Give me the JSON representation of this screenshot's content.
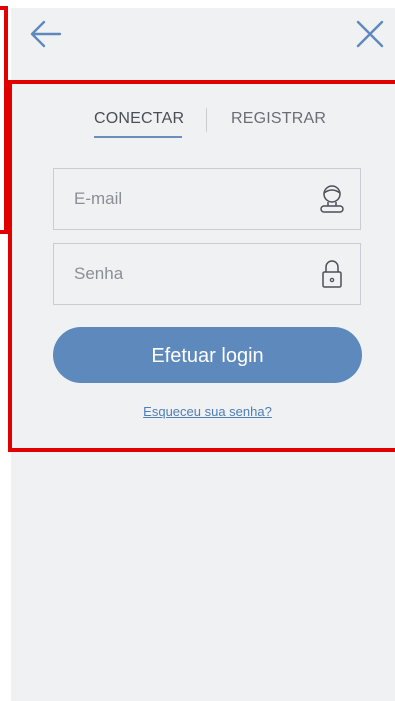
{
  "tabs": {
    "login_label": "CONECTAR",
    "register_label": "REGISTRAR",
    "active": "CONECTAR"
  },
  "form": {
    "email_placeholder": "E-mail",
    "email_value": "",
    "password_placeholder": "Senha",
    "password_value": ""
  },
  "actions": {
    "login_label": "Efetuar login",
    "forgot_label": "Esqueceu sua senha?"
  },
  "icons": {
    "back": "arrow-left-icon",
    "close": "close-icon",
    "email": "user-icon",
    "password": "lock-icon"
  },
  "colors": {
    "accent": "#5e89bd",
    "background": "#f0f1f3",
    "annotation": "#e00000"
  }
}
